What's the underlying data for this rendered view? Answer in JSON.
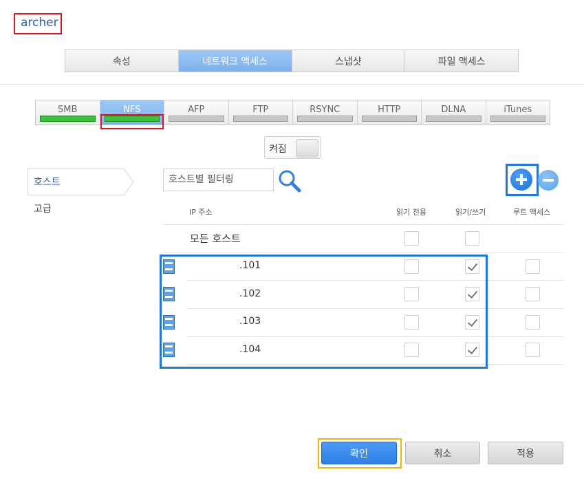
{
  "share_name": "archer",
  "main_tabs": [
    {
      "label": "속성",
      "active": false
    },
    {
      "label": "네트워크 액세스",
      "active": true
    },
    {
      "label": "스냅샷",
      "active": false
    },
    {
      "label": "파일 액세스",
      "active": false
    }
  ],
  "protocol_tabs": [
    {
      "label": "SMB",
      "enabled": true,
      "active": false
    },
    {
      "label": "NFS",
      "enabled": true,
      "active": true
    },
    {
      "label": "AFP",
      "enabled": false,
      "active": false
    },
    {
      "label": "FTP",
      "enabled": false,
      "active": false
    },
    {
      "label": "RSYNC",
      "enabled": false,
      "active": false
    },
    {
      "label": "HTTP",
      "enabled": false,
      "active": false
    },
    {
      "label": "DLNA",
      "enabled": false,
      "active": false
    },
    {
      "label": "iTunes",
      "enabled": false,
      "active": false
    }
  ],
  "service_toggle": {
    "label": "켜짐"
  },
  "left_nav": {
    "host": "호스트",
    "advanced": "고급"
  },
  "filter": {
    "placeholder": "호스트별 필터링"
  },
  "table": {
    "headers": {
      "ip": "IP 주소",
      "read_only": "읽기 전용",
      "read_write": "읽기/쓰기",
      "root_access": "루트 액세스"
    },
    "all_hosts": {
      "label": "모든 호스트",
      "read_only": false,
      "read_write": false
    },
    "rows": [
      {
        "ip": ".101",
        "read_only": false,
        "read_write": true,
        "root_access": false
      },
      {
        "ip": ".102",
        "read_only": false,
        "read_write": true,
        "root_access": false
      },
      {
        "ip": ".103",
        "read_only": false,
        "read_write": true,
        "root_access": false
      },
      {
        "ip": ".104",
        "read_only": false,
        "read_write": true,
        "root_access": false
      }
    ]
  },
  "buttons": {
    "ok": "확인",
    "cancel": "취소",
    "apply": "적용"
  },
  "colors": {
    "accent": "#7fb0ec",
    "enabled_bar": "#37c43a",
    "highlight_red": "#e0141e",
    "highlight_blue": "#1e78dc",
    "highlight_yellow": "#f5b400"
  }
}
